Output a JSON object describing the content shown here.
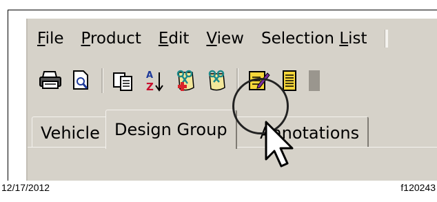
{
  "menu": {
    "items": [
      {
        "prefix": "",
        "hot": "F",
        "rest": "ile"
      },
      {
        "prefix": "",
        "hot": "P",
        "rest": "roduct"
      },
      {
        "prefix": "",
        "hot": "E",
        "rest": "dit"
      },
      {
        "prefix": "",
        "hot": "V",
        "rest": "iew"
      },
      {
        "prefix": "Selection ",
        "hot": "L",
        "rest": "ist"
      }
    ]
  },
  "toolbar": {
    "icons": [
      "printer-icon",
      "print-preview-icon",
      "copy-icon",
      "sort-az-icon",
      "cut-annotation-icon",
      "paste-annotation-icon",
      "edit-note-icon",
      "notes-list-icon"
    ]
  },
  "tabs": {
    "items": [
      "Vehicle",
      "Design Group",
      "Annotations"
    ],
    "active_index": 1
  },
  "footer": {
    "date": "12/17/2012",
    "code": "f120243"
  },
  "colors": {
    "window_bg": "#d6d2c9",
    "highlight_circle": "#222222"
  }
}
